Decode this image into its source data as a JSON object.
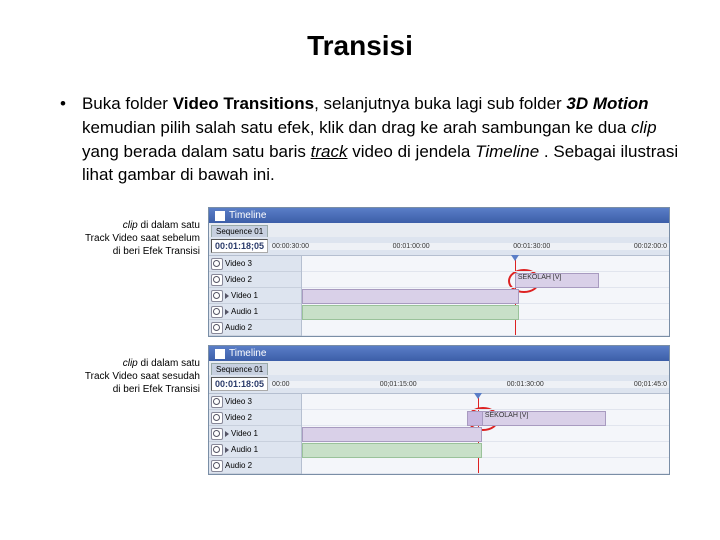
{
  "title": "Transisi",
  "bullet": {
    "pre": "Buka folder ",
    "vt": "Video Transitions",
    "mid1": ", selanjutnya buka lagi sub folder ",
    "tm": "3D Motion",
    "mid2": " kemudian pilih salah satu efek, klik dan drag ke arah sambungan ke dua ",
    "clip": "clip",
    "mid3": " yang berada dalam satu baris ",
    "track": "track",
    "mid4": " video di jendela ",
    "tl": "Timeline",
    "end": " . Sebagai ilustrasi lihat gambar di bawah ini."
  },
  "cap1": {
    "l1": "clip ",
    "l1b": "di dalam satu",
    "l2": "Track Video saat sebelum",
    "l3": "di beri Efek Transisi"
  },
  "cap2": {
    "l1": "clip ",
    "l1b": "di dalam satu",
    "l2": "Track Video saat sesudah",
    "l3": "di beri Efek Transisi"
  },
  "panel": {
    "title": "Timeline",
    "seq": "Sequence 01",
    "tc1": "00:01:18;05",
    "tc2": "00:01:18:05",
    "r1": [
      "00:00:30:00",
      "00:01:00:00",
      "00:01:30:00",
      "00:02:00:0"
    ],
    "r2": [
      "00:00",
      "00;01:15:00",
      "00:01:30:00",
      "00;01:45:0"
    ],
    "v3": "Video 3",
    "v2": "Video 2",
    "v1": "Video 1",
    "a1": "Audio 1",
    "a2": "Audio 2",
    "clip1": "SEKOLAH [V]",
    "clip2": "SEKOLAH [V]",
    "aclip": ""
  }
}
